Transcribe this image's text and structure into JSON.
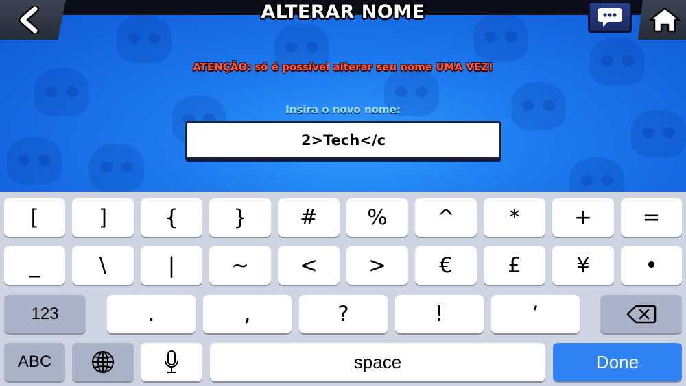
{
  "header": {
    "title": "ALTERAR NOME",
    "back_icon": "chevron-left-icon",
    "chat_icon": "chat-bubble-icon",
    "home_icon": "home-icon"
  },
  "dialog": {
    "warning": "ATENÇÃO: só é possível alterar seu nome UMA VEZ!",
    "prompt": "Insira o novo nome:",
    "name_value": "2>Tech</c"
  },
  "keyboard": {
    "row1": [
      "[",
      "]",
      "{",
      "}",
      "#",
      "%",
      "^",
      "*",
      "+",
      "="
    ],
    "row2": [
      "_",
      "\\",
      "|",
      "~",
      "<",
      ">",
      "€",
      "£",
      "¥",
      "•"
    ],
    "row3": {
      "mode_key": "123",
      "keys": [
        ".",
        ",",
        "?",
        "!",
        "’"
      ],
      "delete_icon": "backspace-icon"
    },
    "row4": {
      "abc_key": "ABC",
      "globe_icon": "globe-icon",
      "mic_icon": "microphone-icon",
      "space_key": "space",
      "done_key": "Done"
    }
  },
  "colors": {
    "background_blue": "#1e7cf0",
    "warning_text": "#ff5a3a",
    "prompt_text": "#9fe0ff",
    "keyboard_bg": "#cfd4e3",
    "done_key": "#2f83f4"
  }
}
